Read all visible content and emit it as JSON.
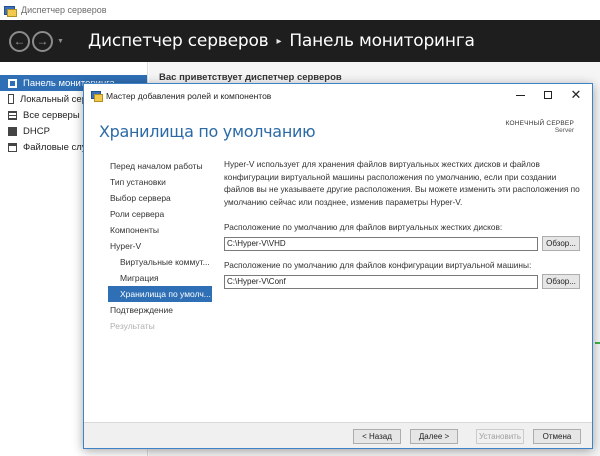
{
  "server_manager": {
    "window_title": "Диспетчер серверов",
    "breadcrumb": {
      "app": "Диспетчер серверов",
      "separator": "▸",
      "page": "Панель мониторинга"
    },
    "sidebar": {
      "items": [
        {
          "label": "Панель мониторинга",
          "icon": "dashboard-icon"
        },
        {
          "label": "Локальный сервер",
          "icon": "local-server-icon"
        },
        {
          "label": "Все серверы",
          "icon": "all-servers-icon"
        },
        {
          "label": "DHCP",
          "icon": "dhcp-icon"
        },
        {
          "label": "Файловые службы",
          "icon": "file-services-icon"
        }
      ]
    },
    "welcome": "Вас приветствует диспетчер серверов"
  },
  "wizard": {
    "title": "Мастер добавления ролей и компонентов",
    "heading": "Хранилища по умолчанию",
    "destination": {
      "label": "КОНЕЧНЫЙ СЕРВЕР",
      "value": "Server"
    },
    "nav": [
      {
        "label": "Перед началом работы",
        "state": "normal"
      },
      {
        "label": "Тип установки",
        "state": "normal"
      },
      {
        "label": "Выбор сервера",
        "state": "normal"
      },
      {
        "label": "Роли сервера",
        "state": "normal"
      },
      {
        "label": "Компоненты",
        "state": "normal"
      },
      {
        "label": "Hyper-V",
        "state": "normal"
      },
      {
        "label": "Виртуальные коммут...",
        "state": "sub"
      },
      {
        "label": "Миграция",
        "state": "sub"
      },
      {
        "label": "Хранилища по умолч...",
        "state": "current"
      },
      {
        "label": "Подтверждение",
        "state": "normal"
      },
      {
        "label": "Результаты",
        "state": "disabled"
      }
    ],
    "description": "Hyper-V использует для хранения файлов виртуальных жестких дисков и файлов конфигурации виртуальной машины расположения по умолчанию, если при создании файлов вы не указываете другие расположения. Вы можете изменить эти расположения по умолчанию сейчас или позднее, изменив параметры Hyper-V.",
    "vhd_field": {
      "label": "Расположение по умолчанию для файлов виртуальных жестких дисков:",
      "value": "C:\\Hyper-V\\VHD",
      "browse": "Обзор..."
    },
    "conf_field": {
      "label": "Расположение по умолчанию для файлов конфигурации виртуальной машины:",
      "value": "C:\\Hyper-V\\Conf",
      "browse": "Обзор..."
    },
    "buttons": {
      "back": "< Назад",
      "next": "Далее >",
      "install": "Установить",
      "cancel": "Отмена"
    },
    "controls": {
      "close": "✕"
    }
  },
  "colors": {
    "accent": "#2f6fb5",
    "header_bg": "#1e1e1e",
    "heading": "#2b6aa6",
    "progress_green": "#3fb24a"
  }
}
